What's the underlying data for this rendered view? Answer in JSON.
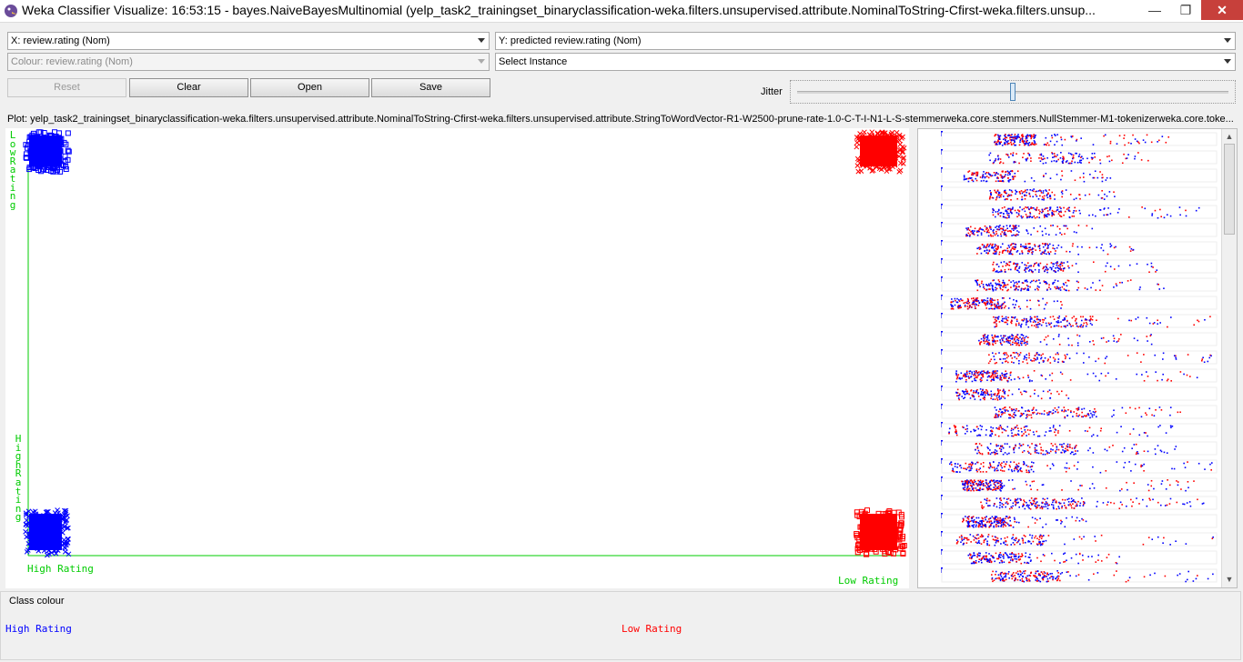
{
  "window": {
    "title": "Weka Classifier Visualize: 16:53:15 - bayes.NaiveBayesMultinomial (yelp_task2_trainingset_binaryclassification-weka.filters.unsupervised.attribute.NominalToString-Cfirst-weka.filters.unsup...",
    "minimize": "—",
    "maximize": "❐",
    "close": "✕"
  },
  "controls": {
    "x_axis": "X: review.rating (Nom)",
    "y_axis": "Y: predicted review.rating (Nom)",
    "colour": "Colour: review.rating (Nom)",
    "select_instance": "Select Instance",
    "reset": "Reset",
    "clear": "Clear",
    "open": "Open",
    "save": "Save",
    "jitter_label": "Jitter",
    "jitter_level": 0.5
  },
  "plot": {
    "caption": "Plot: yelp_task2_trainingset_binaryclassification-weka.filters.unsupervised.attribute.NominalToString-Cfirst-weka.filters.unsupervised.attribute.StringToWordVector-R1-W2500-prune-rate-1.0-C-T-I-N1-L-S-stemmerweka.core.stemmers.NullStemmer-M1-tokenizerweka.core.toke...",
    "y_top_label": "Low Rating",
    "y_bottom_label": "High Rating",
    "x_left_label": "High Rating",
    "x_right_label": "Low Rating"
  },
  "chart_data": {
    "type": "scatter",
    "x_categories": [
      "High Rating",
      "Low Rating"
    ],
    "y_categories": [
      "High Rating",
      "Low Rating"
    ],
    "colour_by": "review.rating",
    "clusters": [
      {
        "x": "High Rating",
        "y": "Low Rating",
        "colour": "High Rating",
        "marker": "square"
      },
      {
        "x": "Low Rating",
        "y": "Low Rating",
        "colour": "Low Rating",
        "marker": "cross"
      },
      {
        "x": "High Rating",
        "y": "High Rating",
        "colour": "High Rating",
        "marker": "cross"
      },
      {
        "x": "Low Rating",
        "y": "High Rating",
        "colour": "Low Rating",
        "marker": "square"
      }
    ]
  },
  "class_colour": {
    "title": "Class colour",
    "classes": [
      {
        "name": "High Rating",
        "color": "#0000ff"
      },
      {
        "name": "Low Rating",
        "color": "#ff0000"
      }
    ]
  },
  "colors": {
    "high": "#0000ff",
    "low": "#ff0000",
    "axis": "#00cc00"
  },
  "icons": {
    "app": "weka-bird-icon",
    "dropdown": "chevron-down-icon"
  }
}
